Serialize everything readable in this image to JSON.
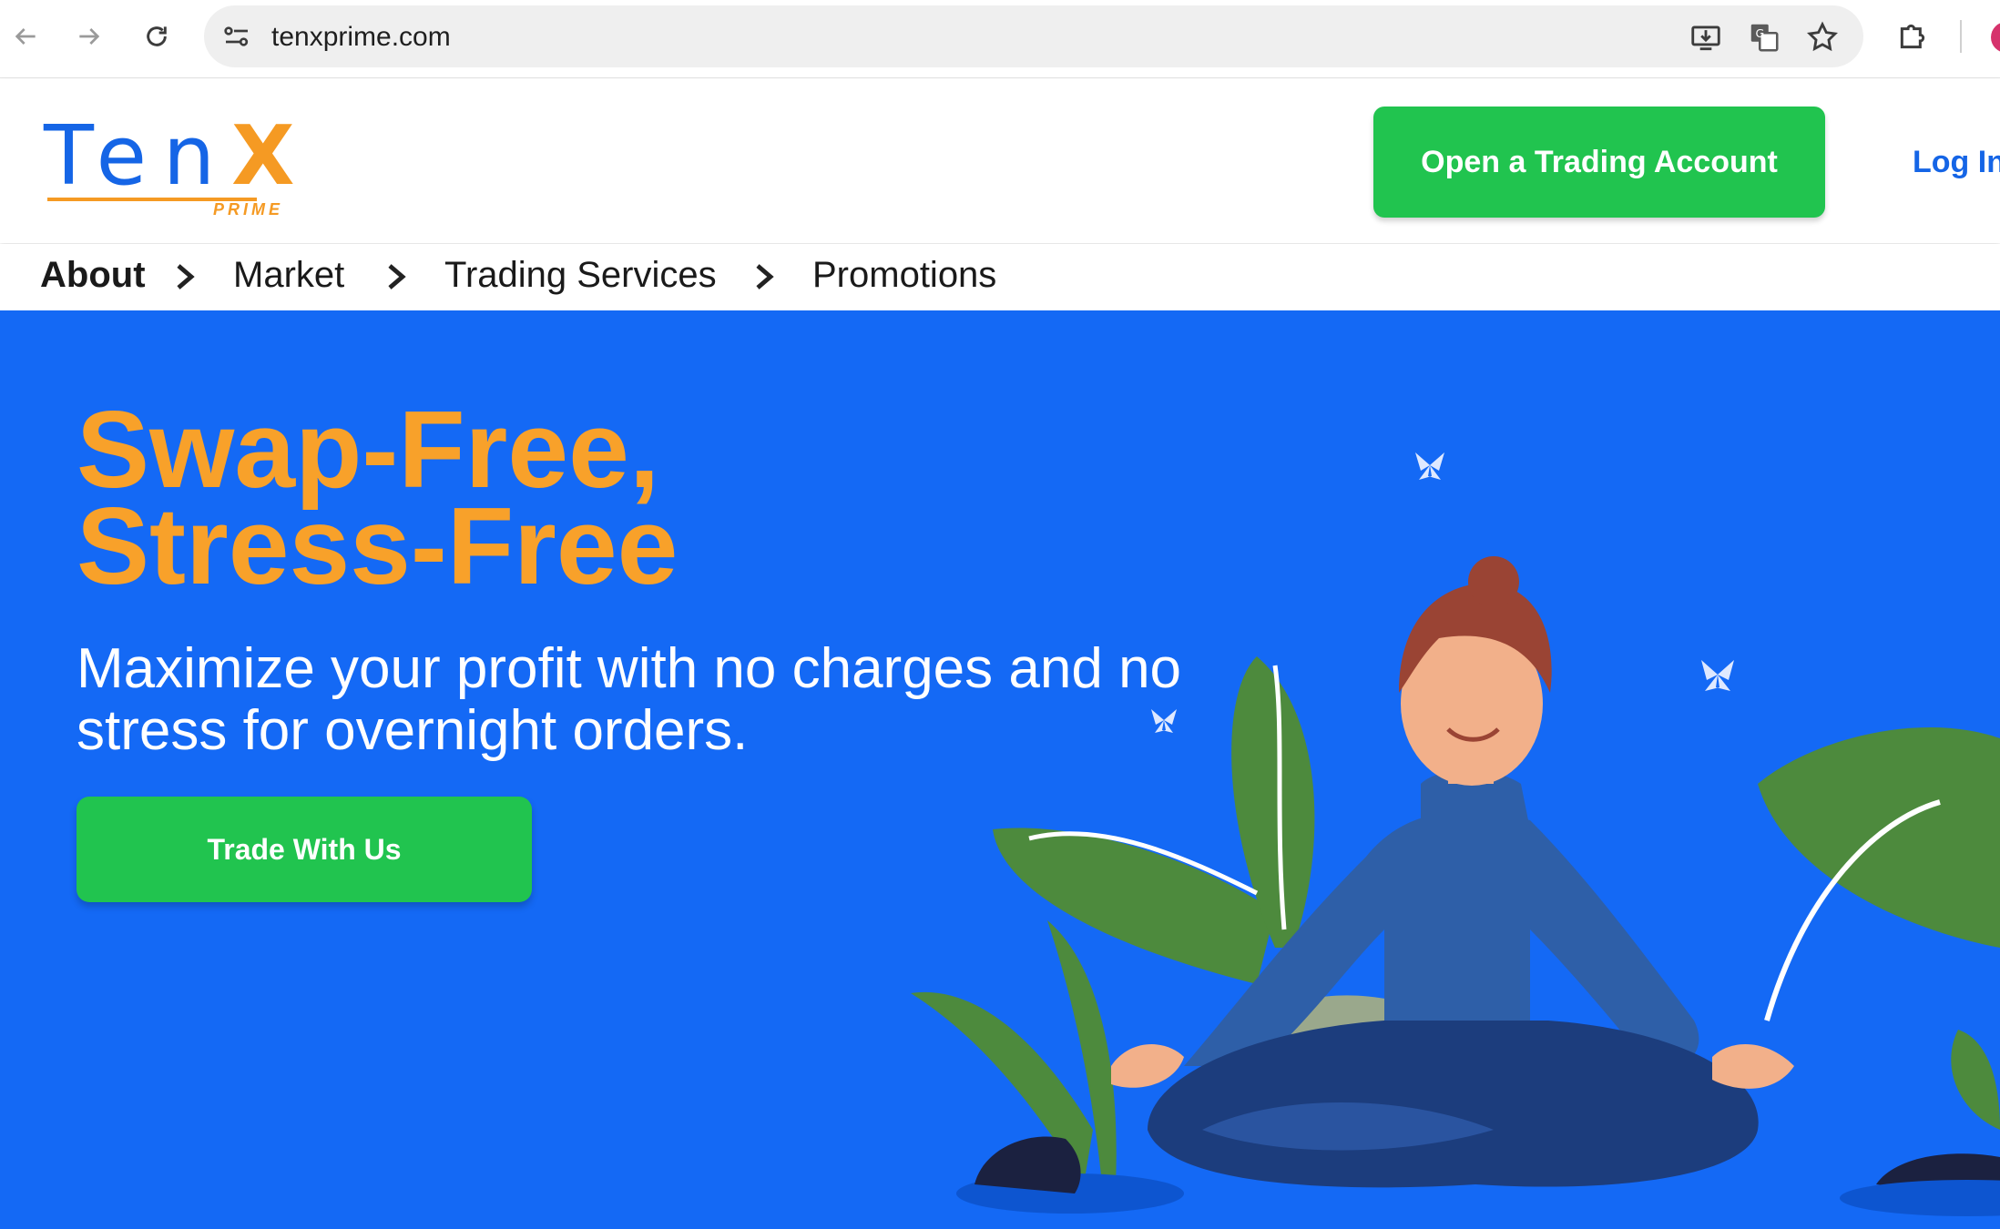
{
  "browser": {
    "url": "tenxprime.com"
  },
  "header": {
    "logo_text": "TenX",
    "logo_sub": "PRIME",
    "open_account_label": "Open a Trading Account",
    "login_label": "Log In"
  },
  "menu": {
    "items": [
      {
        "label": "About"
      },
      {
        "label": "Market"
      },
      {
        "label": "Trading Services"
      },
      {
        "label": "Promotions"
      }
    ]
  },
  "hero": {
    "title_line1": "Swap-Free,",
    "title_line2": "Stress-Free",
    "subtitle": "Maximize your profit with no charges and no stress for overnight orders.",
    "cta_label": "Trade With Us"
  },
  "colors": {
    "brand_blue": "#1565e6",
    "hero_blue": "#1469f5",
    "accent_orange": "#f8a12a",
    "cta_green": "#21c44f"
  },
  "icons": {
    "back": "back-arrow-icon",
    "forward": "forward-arrow-icon",
    "reload": "reload-icon",
    "site_info": "site-settings-icon",
    "install": "install-app-icon",
    "translate": "translate-icon",
    "bookmark": "star-icon",
    "extensions": "puzzle-icon"
  }
}
